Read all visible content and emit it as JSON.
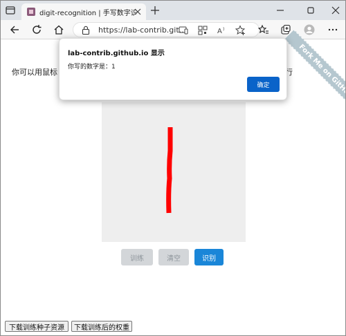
{
  "browser": {
    "tab": {
      "title": "digit-recognition | 手写数字识别"
    },
    "address": {
      "url": "https://lab-contrib.git..."
    }
  },
  "page": {
    "instruction": "你可以用鼠标",
    "instruction_tail": "进行",
    "fork_ribbon": "Fork Me on GitHub",
    "buttons": {
      "train": "训练",
      "clear": "清空",
      "recognize": "识别"
    },
    "downloads": {
      "seed": "下载训练种子资源",
      "weights": "下载训练后的权重"
    },
    "colors": {
      "stroke": "#ff0000",
      "canvas_bg": "#eeeeee",
      "primary": "#1a86d8"
    }
  },
  "dialog": {
    "title": "lab-contrib.github.io 显示",
    "message": "你写的数字是：1",
    "ok": "确定"
  }
}
